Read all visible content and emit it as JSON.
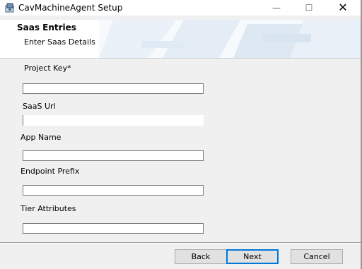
{
  "window": {
    "title": "CavMachineAgent Setup",
    "minimize_glyph": "—",
    "maximize_glyph": "☐",
    "close_glyph": "✕"
  },
  "banner": {
    "title": "Saas Entries",
    "subtitle": "Enter Saas Details"
  },
  "fields": [
    {
      "label": "Project Key*",
      "value": ""
    },
    {
      "label": "SaaS Url",
      "value": ""
    },
    {
      "label": "App Name",
      "value": ""
    },
    {
      "label": "Endpoint Prefix",
      "value": ""
    },
    {
      "label": "Tier Attributes",
      "value": ""
    }
  ],
  "buttons": {
    "back": "Back",
    "next": "Next",
    "cancel": "Cancel"
  },
  "colors": {
    "focus_border": "#0078d7"
  }
}
